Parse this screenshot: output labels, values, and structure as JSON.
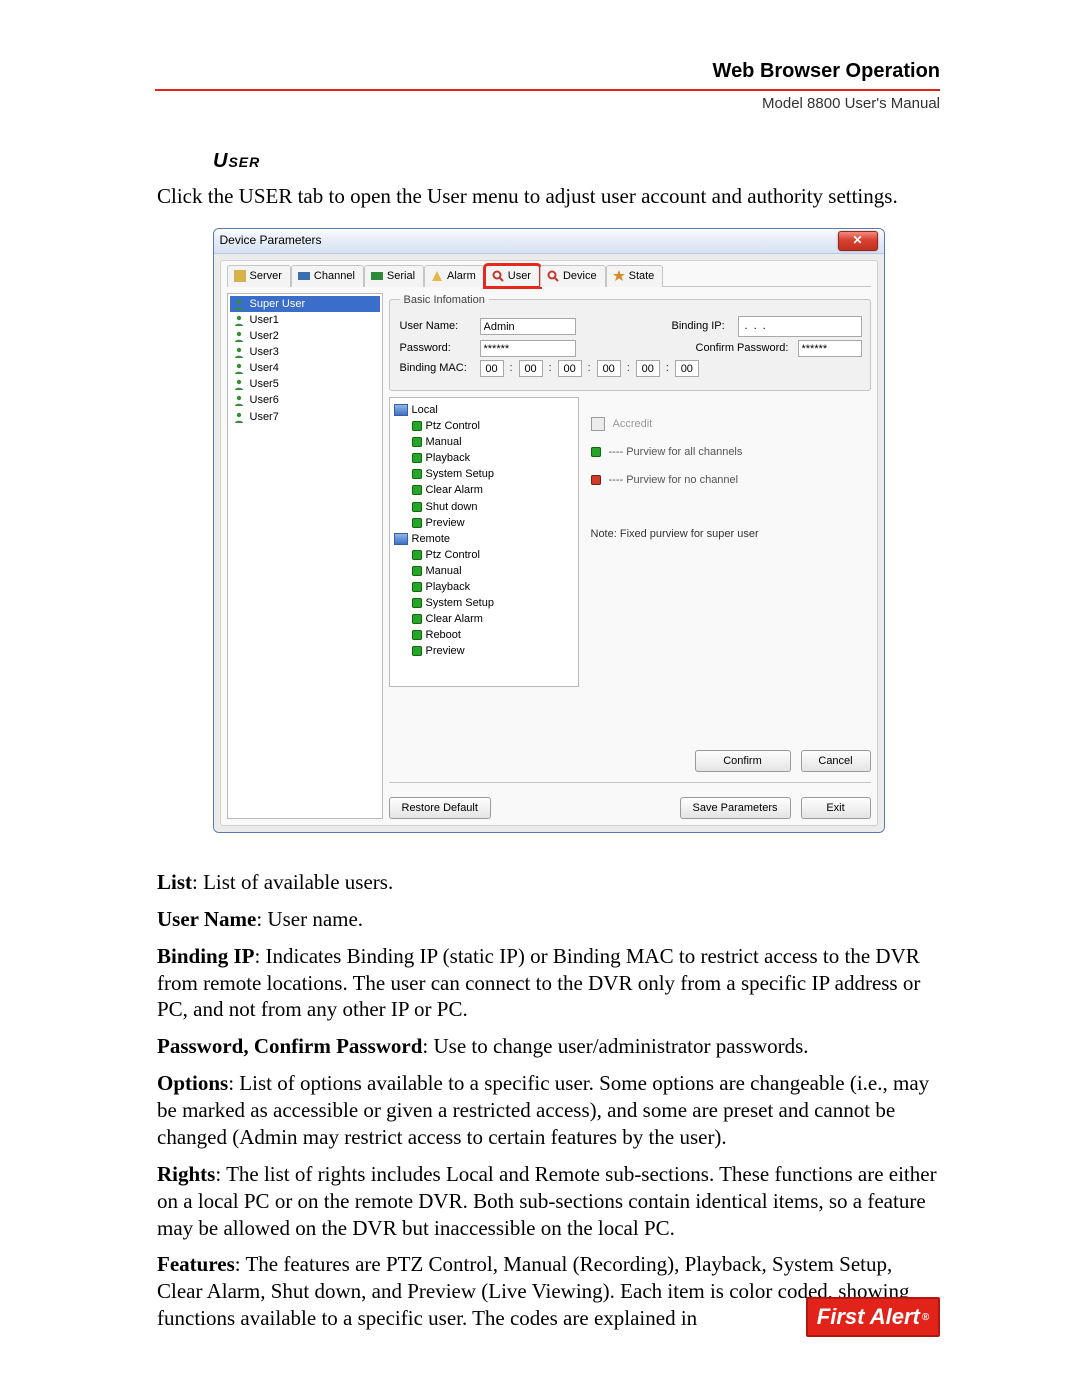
{
  "header": {
    "title": "Web Browser Operation",
    "subtitle": "Model 8800 User's Manual"
  },
  "section": {
    "heading": "User"
  },
  "intro": "Click the USER tab to open the User menu to adjust user account and authority settings.",
  "paras": [
    {
      "b": "List",
      "t": ": List of available users."
    },
    {
      "b": "User Name",
      "t": ": User name."
    },
    {
      "b": "Binding IP",
      "t": ": Indicates Binding IP (static IP) or Binding MAC to restrict access to the DVR from remote locations. The user can connect to the DVR only from a specific IP address or PC, and not from any other IP or PC."
    },
    {
      "b": "Password, Confirm Password",
      "t": ": Use to change user/administrator passwords."
    },
    {
      "b": "Options",
      "t": ": List of options available to a specific user. Some options are changeable (i.e., may be marked as accessible or given a restricted access), and some are preset and cannot be changed (Admin may restrict access to certain features by the user)."
    },
    {
      "b": "Rights",
      "t": ": The list of rights includes Local and Remote sub-sections. These functions are either on a local PC or on the remote DVR. Both sub-sections contain identical items, so a feature may be allowed on the DVR but inaccessible on the local PC."
    },
    {
      "b": "Features",
      "t": ": The features are PTZ Control, Manual (Recording), Playback, System Setup, Clear Alarm, Shut down, and Preview (Live Viewing). Each item is color coded, showing functions available to a specific user. The codes are explained in"
    }
  ],
  "shot": {
    "title": "Device Parameters",
    "tabs": [
      "Server",
      "Channel",
      "Serial",
      "Alarm",
      "User",
      "Device",
      "State"
    ],
    "active_tab": 4,
    "users": {
      "selected": "Super User",
      "items": [
        "User1",
        "User2",
        "User3",
        "User4",
        "User5",
        "User6",
        "User7"
      ]
    },
    "basic": {
      "legend": "Basic Infomation",
      "username_lbl": "User Name:",
      "username": "Admin",
      "bindingip_lbl": "Binding IP:",
      "bindingip": [
        "",
        "",
        "",
        ""
      ],
      "password_lbl": "Password:",
      "password": "******",
      "confirm_lbl": "Confirm Password:",
      "confirm": "******",
      "mac_lbl": "Binding MAC:",
      "mac": [
        "00",
        "00",
        "00",
        "00",
        "00",
        "00"
      ]
    },
    "tree": {
      "local": "Local",
      "remote": "Remote",
      "local_items": [
        "Ptz Control",
        "Manual",
        "Playback",
        "System Setup",
        "Clear Alarm",
        "Shut down",
        "Preview"
      ],
      "remote_items": [
        "Ptz Control",
        "Manual",
        "Playback",
        "System Setup",
        "Clear Alarm",
        "Reboot",
        "Preview"
      ]
    },
    "legend_panel": {
      "accredit": "Accredit",
      "all": "---- Purview for all channels",
      "none": "---- Purview for no channel",
      "note": "Note: Fixed purview for super user"
    },
    "buttons": {
      "confirm": "Confirm",
      "cancel": "Cancel",
      "restore": "Restore Default",
      "save": "Save Parameters",
      "exit": "Exit"
    }
  },
  "logo": "First Alert"
}
